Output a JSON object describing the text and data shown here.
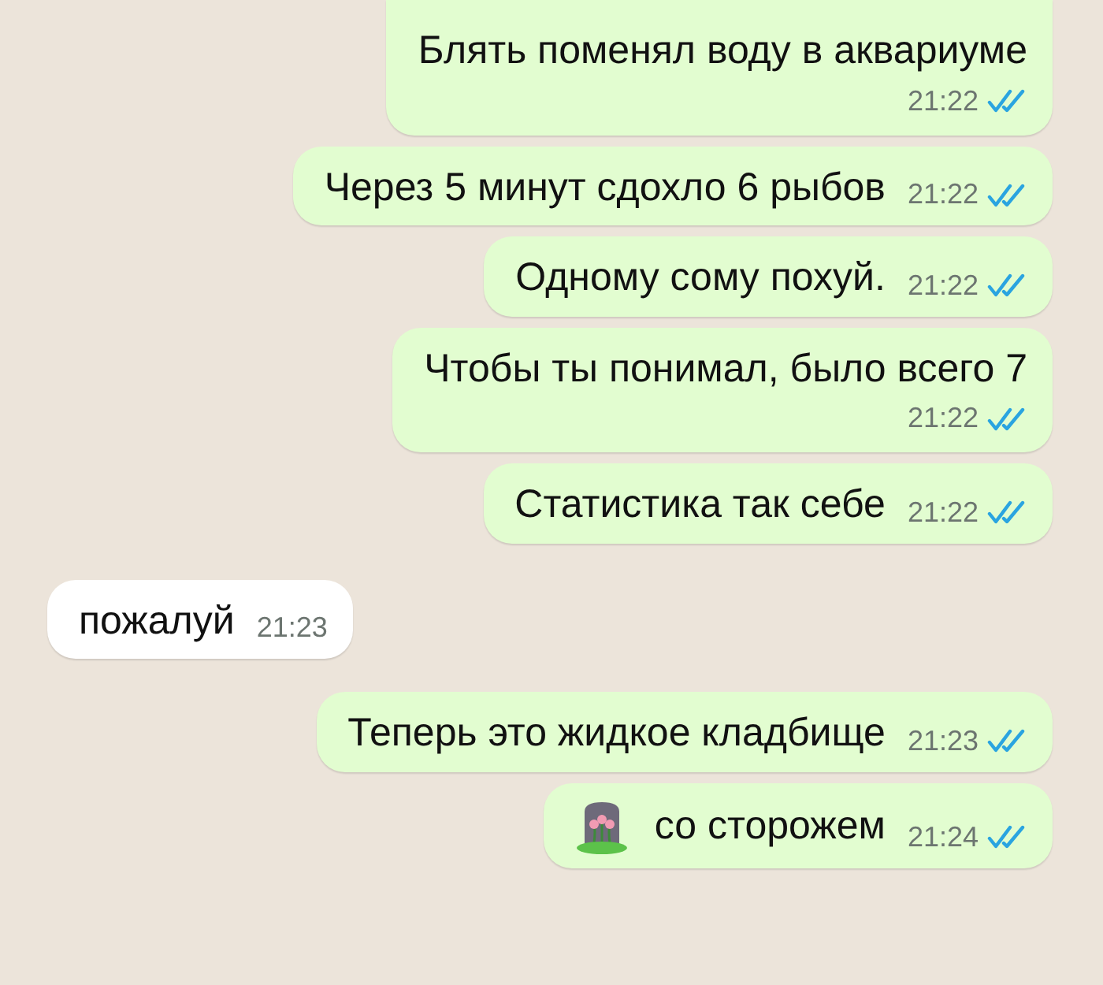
{
  "messages": [
    {
      "kind": "outgoing",
      "text": "Блять поменял воду в аквариуме",
      "time": "21:22",
      "read": true,
      "time_below": true
    },
    {
      "kind": "outgoing",
      "text": "Через 5 минут сдохло 6 рыбов",
      "time": "21:22",
      "read": true,
      "time_below": false
    },
    {
      "kind": "outgoing",
      "text": "Одному сому похуй.",
      "time": "21:22",
      "read": true,
      "time_below": false
    },
    {
      "kind": "outgoing",
      "text": "Чтобы ты понимал, было всего 7",
      "time": "21:22",
      "read": true,
      "time_below": true
    },
    {
      "kind": "outgoing",
      "text": "Статистика так себе",
      "time": "21:22",
      "read": true,
      "time_below": false
    },
    {
      "kind": "incoming",
      "text": "пожалуй",
      "time": "21:23",
      "time_below": false
    },
    {
      "kind": "outgoing",
      "text": "Теперь это жидкое кладбище",
      "time": "21:23",
      "read": true,
      "time_below": false
    },
    {
      "kind": "outgoing",
      "text": "со сторожем",
      "time": "21:24",
      "read": true,
      "time_below": false,
      "headstone_emoji": true
    }
  ]
}
